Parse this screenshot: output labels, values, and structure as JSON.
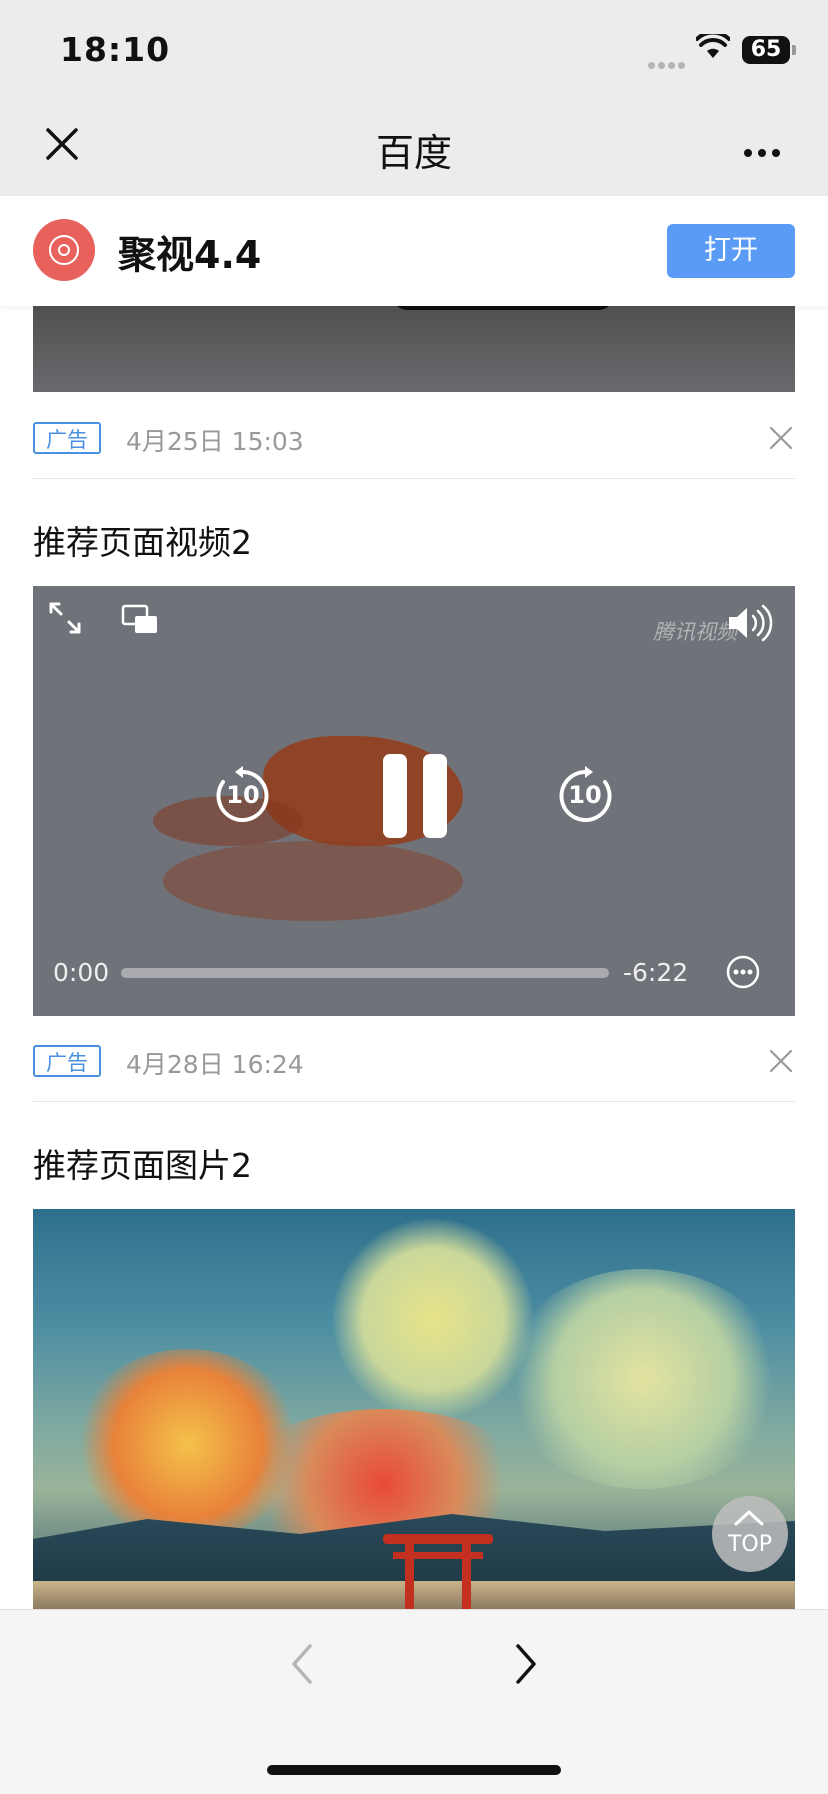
{
  "status_bar": {
    "time": "18:10",
    "battery": "65"
  },
  "nav": {
    "title": "百度"
  },
  "app_banner": {
    "name": "聚视4.4",
    "open_label": "打开"
  },
  "feed": {
    "items": [
      {
        "ad_tag": "广告",
        "date": "4月25日 15:03"
      },
      {
        "title": "推荐页面视频2",
        "ad_tag": "广告",
        "date": "4月28日 16:24"
      },
      {
        "title": "推荐页面图片2"
      }
    ]
  },
  "video": {
    "watermark": "腾讯视频",
    "elapsed": "0:00",
    "remaining": "-6:22",
    "progress": 0,
    "skip_back_seconds": "10",
    "skip_forward_seconds": "10"
  },
  "top_button": {
    "label": "TOP"
  },
  "colors": {
    "accent": "#5a9cf5",
    "ad_tag": "#4a90e2",
    "app_icon": "#e8615c"
  }
}
